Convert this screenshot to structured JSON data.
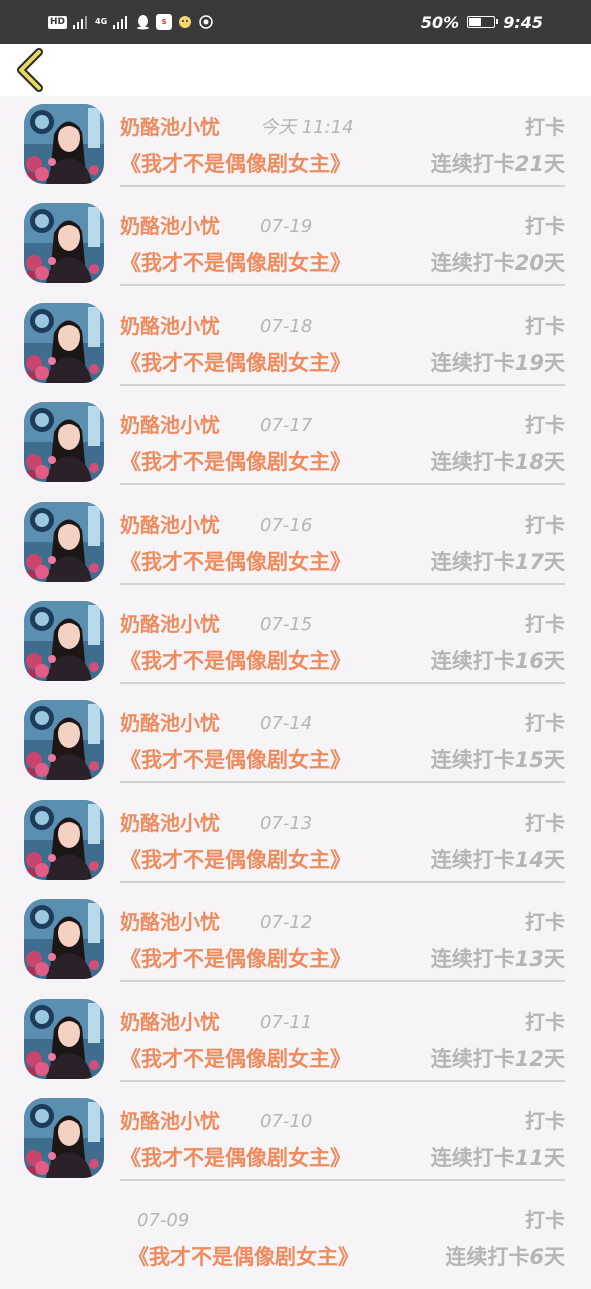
{
  "status_bar": {
    "hd": "HD",
    "signal_label": "4G",
    "battery_percent_text": "50%",
    "battery_level": 0.5,
    "time": "9:45"
  },
  "header": {
    "back_icon": "chevron-left-icon",
    "accent_color": "#e8d95c"
  },
  "colors": {
    "name": "#ee8c5f",
    "muted": "#b5b5b5",
    "background": "#f7f4f7"
  },
  "checkins": [
    {
      "name": "奶酪池小忧",
      "time": "今天 11:14",
      "action": "打卡",
      "book": "《我才不是偶像剧女主》",
      "streak_prefix": "连续打卡",
      "streak_days": "21",
      "streak_suffix": "天"
    },
    {
      "name": "奶酪池小忧",
      "time": "07-19",
      "action": "打卡",
      "book": "《我才不是偶像剧女主》",
      "streak_prefix": "连续打卡",
      "streak_days": "20",
      "streak_suffix": "天"
    },
    {
      "name": "奶酪池小忧",
      "time": "07-18",
      "action": "打卡",
      "book": "《我才不是偶像剧女主》",
      "streak_prefix": "连续打卡",
      "streak_days": "19",
      "streak_suffix": "天"
    },
    {
      "name": "奶酪池小忧",
      "time": "07-17",
      "action": "打卡",
      "book": "《我才不是偶像剧女主》",
      "streak_prefix": "连续打卡",
      "streak_days": "18",
      "streak_suffix": "天"
    },
    {
      "name": "奶酪池小忧",
      "time": "07-16",
      "action": "打卡",
      "book": "《我才不是偶像剧女主》",
      "streak_prefix": "连续打卡",
      "streak_days": "17",
      "streak_suffix": "天"
    },
    {
      "name": "奶酪池小忧",
      "time": "07-15",
      "action": "打卡",
      "book": "《我才不是偶像剧女主》",
      "streak_prefix": "连续打卡",
      "streak_days": "16",
      "streak_suffix": "天"
    },
    {
      "name": "奶酪池小忧",
      "time": "07-14",
      "action": "打卡",
      "book": "《我才不是偶像剧女主》",
      "streak_prefix": "连续打卡",
      "streak_days": "15",
      "streak_suffix": "天"
    },
    {
      "name": "奶酪池小忧",
      "time": "07-13",
      "action": "打卡",
      "book": "《我才不是偶像剧女主》",
      "streak_prefix": "连续打卡",
      "streak_days": "14",
      "streak_suffix": "天"
    },
    {
      "name": "奶酪池小忧",
      "time": "07-12",
      "action": "打卡",
      "book": "《我才不是偶像剧女主》",
      "streak_prefix": "连续打卡",
      "streak_days": "13",
      "streak_suffix": "天"
    },
    {
      "name": "奶酪池小忧",
      "time": "07-11",
      "action": "打卡",
      "book": "《我才不是偶像剧女主》",
      "streak_prefix": "连续打卡",
      "streak_days": "12",
      "streak_suffix": "天"
    },
    {
      "name": "奶酪池小忧",
      "time": "07-10",
      "action": "打卡",
      "book": "《我才不是偶像剧女主》",
      "streak_prefix": "连续打卡",
      "streak_days": "11",
      "streak_suffix": "天"
    }
  ],
  "last_checkin": {
    "time": "07-09",
    "action": "打卡",
    "book": "《我才不是偶像剧女主》",
    "streak_prefix": "连续打卡",
    "streak_days": "6",
    "streak_suffix": "天"
  }
}
